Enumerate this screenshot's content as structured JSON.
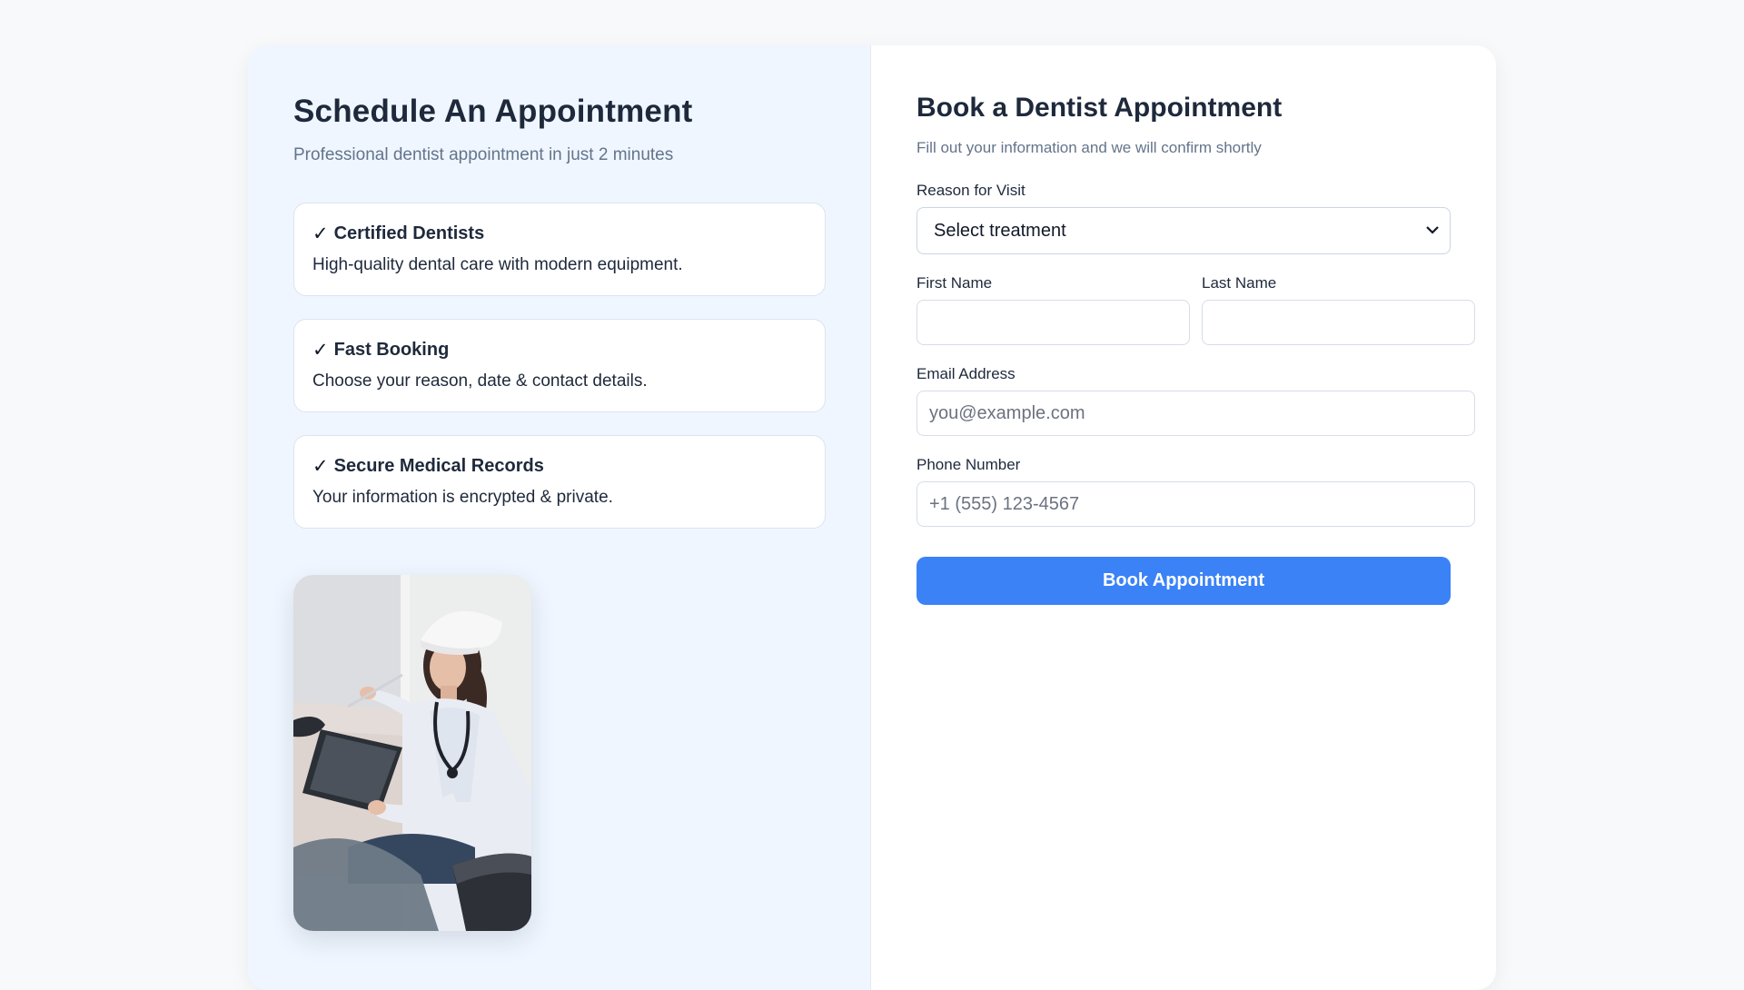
{
  "left": {
    "title": "Schedule An Appointment",
    "subtitle": "Professional dentist appointment in just 2 minutes",
    "features": [
      {
        "check": "✓",
        "title": "Certified Dentists",
        "description": "High-quality dental care with modern equipment."
      },
      {
        "check": "✓",
        "title": "Fast Booking",
        "description": "Choose your reason, date & contact details."
      },
      {
        "check": "✓",
        "title": "Secure Medical Records",
        "description": "Your information is encrypted & private."
      }
    ]
  },
  "form": {
    "title": "Book a Dentist Appointment",
    "subtitle": "Fill out your information and we will confirm shortly",
    "reason": {
      "label": "Reason for Visit",
      "selected": "Select treatment"
    },
    "first_name": {
      "label": "First Name",
      "value": "",
      "placeholder": ""
    },
    "last_name": {
      "label": "Last Name",
      "value": "",
      "placeholder": ""
    },
    "email": {
      "label": "Email Address",
      "value": "",
      "placeholder": "you@example.com"
    },
    "phone": {
      "label": "Phone Number",
      "value": "",
      "placeholder": "+1 (555) 123-4567"
    },
    "submit_label": "Book Appointment"
  },
  "colors": {
    "accent": "#3b82f6",
    "left_panel_bg": "#eff6ff",
    "page_bg": "#f7f9fb",
    "heading": "#1e293b",
    "muted": "#64748b"
  }
}
